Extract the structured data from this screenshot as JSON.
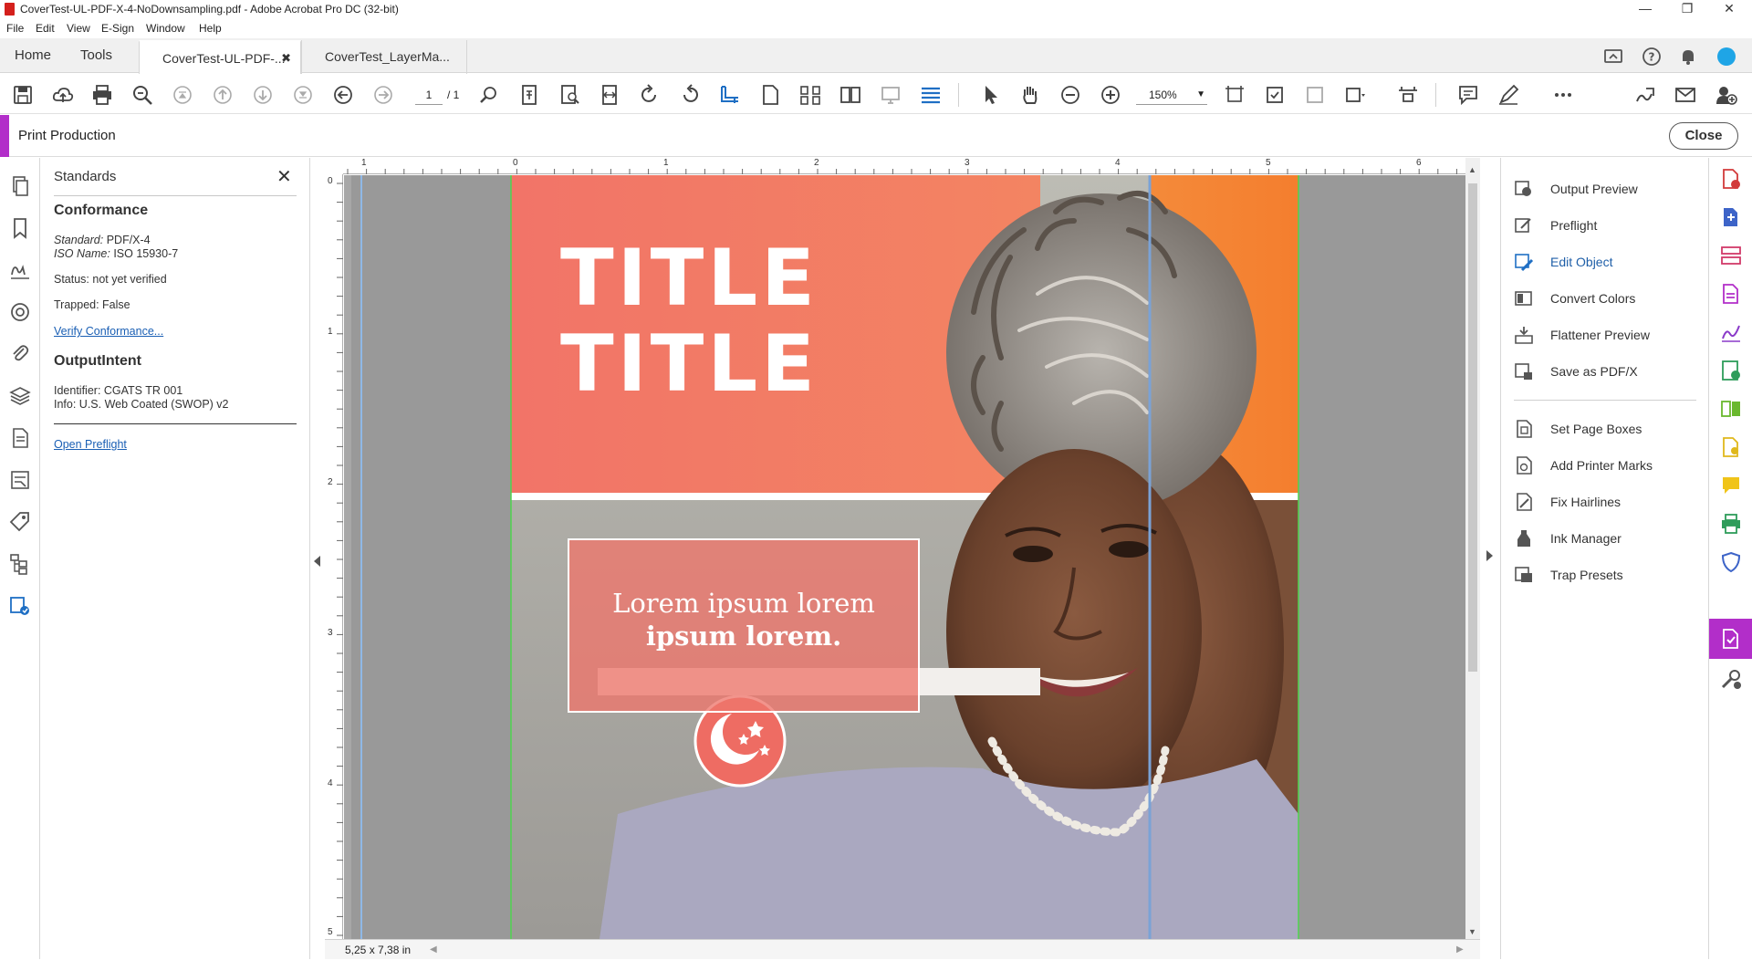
{
  "window": {
    "title": "CoverTest-UL-PDF-X-4-NoDownsampling.pdf - Adobe Acrobat Pro DC (32-bit)"
  },
  "menu": [
    "File",
    "Edit",
    "View",
    "E-Sign",
    "Window",
    "Help"
  ],
  "tabs": {
    "home": "Home",
    "tools": "Tools",
    "doc1": "CoverTest-UL-PDF-...",
    "doc2": "CoverTest_LayerMa..."
  },
  "toolbar": {
    "page_current": "1",
    "page_total": "/ 1",
    "zoom": "150%"
  },
  "print_production": {
    "label": "Print Production",
    "close_label": "Close"
  },
  "standards": {
    "header": "Standards",
    "conformance_title": "Conformance",
    "standard_label": "Standard:",
    "standard_value": "PDF/X-4",
    "iso_label": "ISO Name:",
    "iso_value": "ISO 15930-7",
    "status": "Status: not yet verified",
    "trapped": "Trapped: False",
    "verify_link": "Verify Conformance...",
    "output_intent_title": "OutputIntent",
    "identifier": "Identifier: CGATS TR 001",
    "info": "Info: U.S. Web Coated (SWOP) v2",
    "open_preflight_link": "Open Preflight"
  },
  "ruler": {
    "top_labels": [
      "1",
      "0",
      "1",
      "2",
      "3",
      "4",
      "5",
      "6"
    ],
    "left_labels": [
      "0",
      "1",
      "2",
      "3",
      "4",
      "5"
    ]
  },
  "document": {
    "title_line1": "TITLE",
    "title_line2": "TITLE",
    "lorem_line1": "Lorem ipsum lorem",
    "lorem_line2": "ipsum lorem.",
    "colors": {
      "coral": "#f07467",
      "orange": "#f47d30",
      "pasteboard": "#999999"
    }
  },
  "status_bar": {
    "dimensions": "5,25 x 7,38 in"
  },
  "tools_panel": {
    "group1": [
      "Output Preview",
      "Preflight",
      "Edit Object",
      "Convert Colors",
      "Flattener Preview",
      "Save as PDF/X"
    ],
    "group2": [
      "Set Page Boxes",
      "Add Printer Marks",
      "Fix Hairlines",
      "Ink Manager",
      "Trap Presets"
    ],
    "active_tool": "Edit Object"
  }
}
